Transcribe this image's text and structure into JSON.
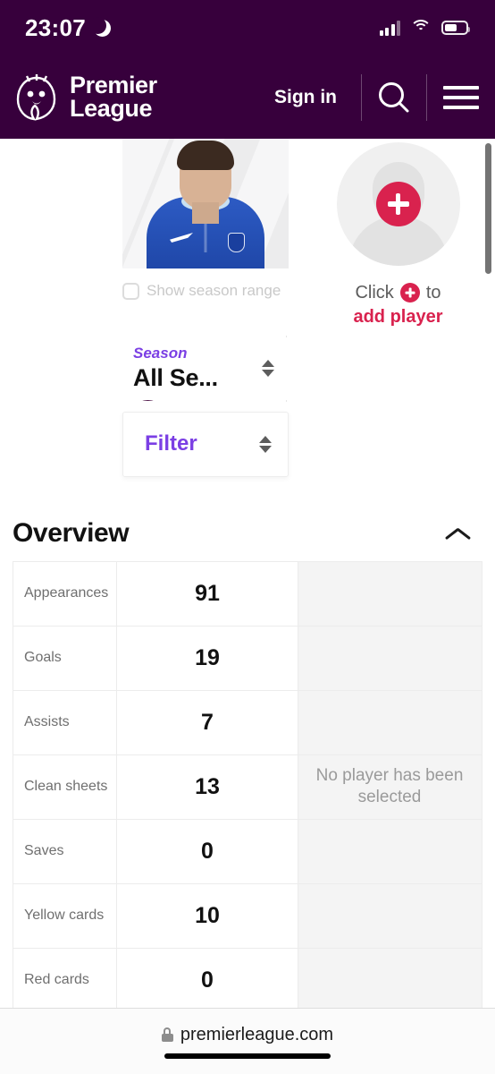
{
  "status_bar": {
    "time": "23:07",
    "moon_icon": "crescent-moon-icon",
    "signal_icon": "cellular-signal-icon",
    "wifi_icon": "wifi-icon",
    "battery_icon": "battery-icon",
    "battery_level": "58%"
  },
  "header": {
    "logo_line1": "Premier",
    "logo_line2": "League",
    "sign_in": "Sign in",
    "search_icon": "search-icon",
    "menu_icon": "hamburger-menu-icon",
    "brand_color": "#37003c"
  },
  "compare": {
    "player_card": {
      "remove_icon": "minus-icon",
      "photo_alt": "player-photo",
      "season_range_label": "Show season range",
      "season_range_checked": false
    },
    "add_card": {
      "avatar_icon": "player-silhouette-icon",
      "plus_icon": "plus-icon",
      "prompt_prefix": "Click",
      "prompt_suffix": "to",
      "prompt_action": "add player",
      "accent_color": "#d9224e"
    }
  },
  "filters": {
    "season": {
      "label": "Season",
      "value": "All Se...",
      "stepper_icon": "up-down-arrows-icon"
    },
    "filter": {
      "label": "Filter",
      "stepper_icon": "up-down-arrows-icon"
    },
    "accent_color": "#7b3fe4"
  },
  "overview": {
    "title": "Overview",
    "collapse_icon": "chevron-up-icon",
    "empty_state": "No player has been selected",
    "rows": [
      {
        "label": "Appearances",
        "value": "91"
      },
      {
        "label": "Goals",
        "value": "19"
      },
      {
        "label": "Assists",
        "value": "7"
      },
      {
        "label": "Clean sheets",
        "value": "13"
      },
      {
        "label": "Saves",
        "value": "0"
      },
      {
        "label": "Yellow cards",
        "value": "10"
      },
      {
        "label": "Red cards",
        "value": "0"
      }
    ]
  },
  "browser_bar": {
    "lock_icon": "lock-icon",
    "url": "premierleague.com",
    "home_indicator": "home-indicator"
  }
}
